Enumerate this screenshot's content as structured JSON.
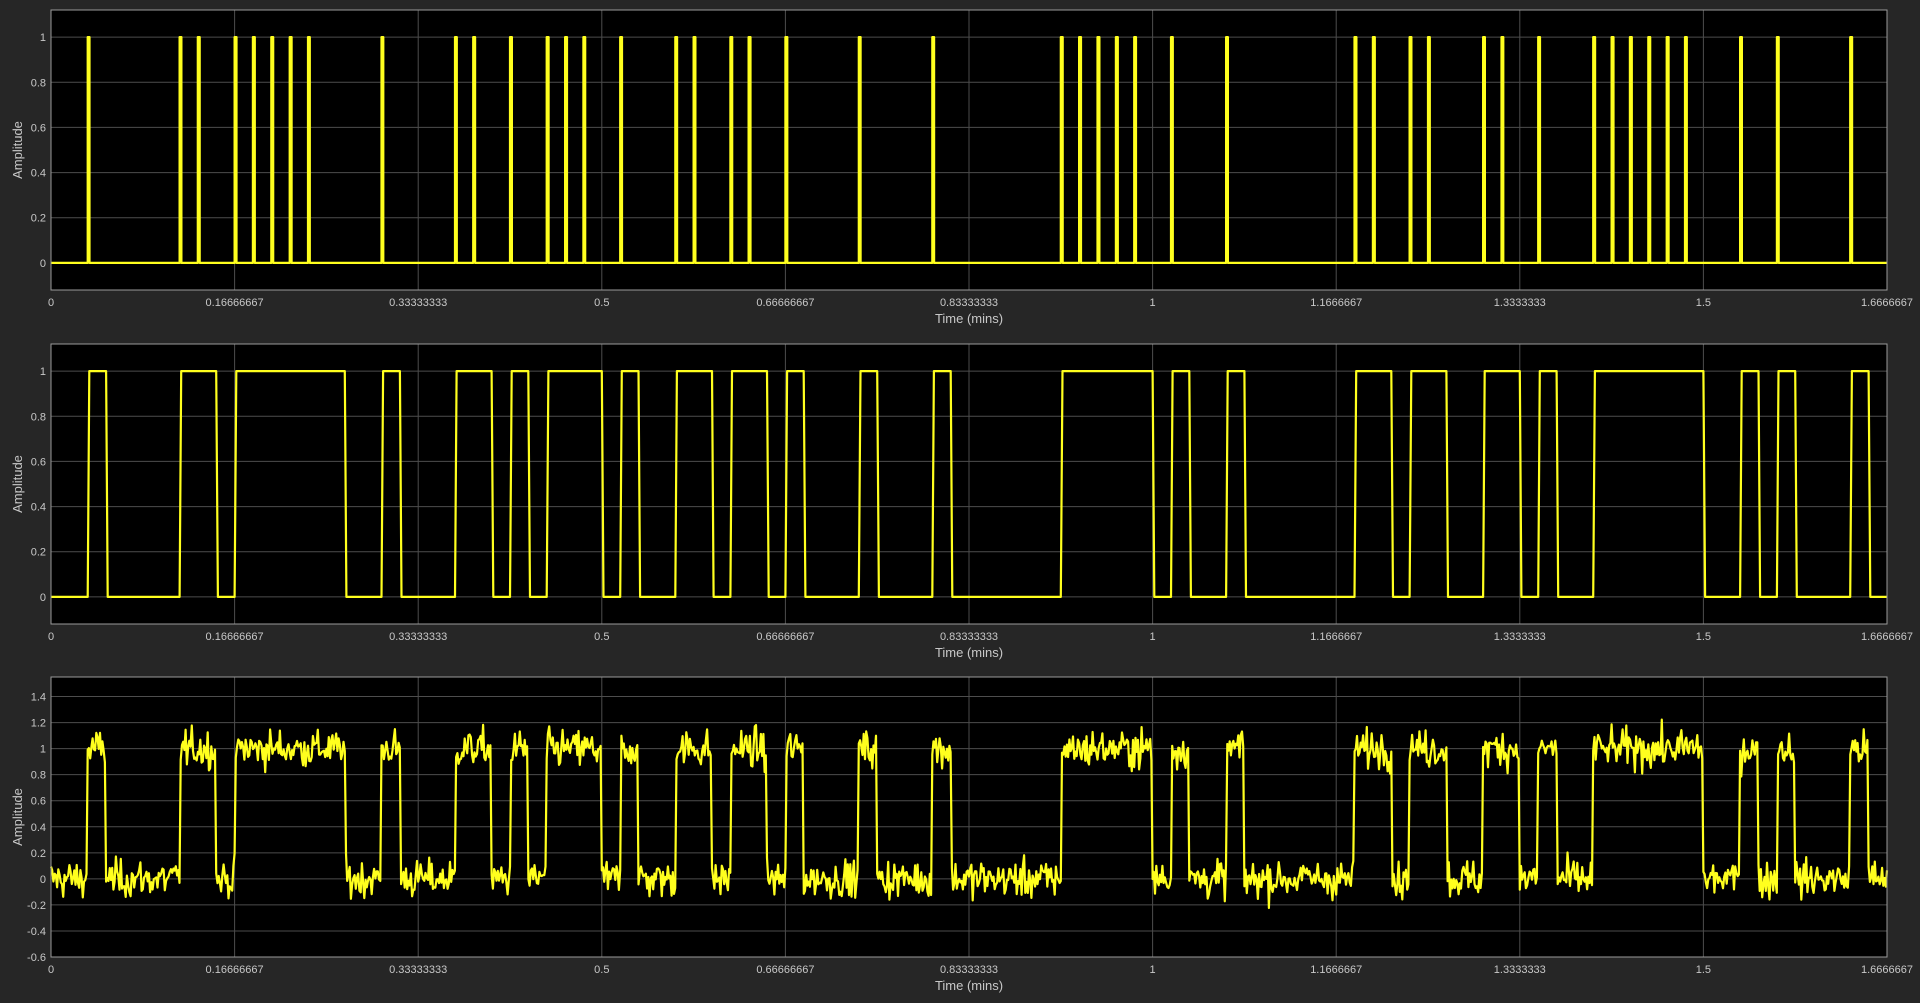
{
  "colors": {
    "figure_background": "#262626",
    "axes_background": "#000000",
    "grid": "#4d4d4d",
    "axis_line": "#9a9a9a",
    "text": "#c8c8c8",
    "trace": "#ffff1e"
  },
  "chart_data": [
    {
      "type": "line",
      "ylabel": "Amplitude",
      "xlabel": "Time (mins)",
      "xlim": [
        0,
        1.6666667
      ],
      "ylim": [
        -0.12,
        1.12
      ],
      "grid": true,
      "xticks": [
        0,
        0.16666667,
        0.33333333,
        0.5,
        0.66666667,
        0.83333333,
        1,
        1.1666667,
        1.3333333,
        1.5,
        1.6666667
      ],
      "xtick_labels": [
        "0",
        "0.16666667",
        "0.33333333",
        "0.5",
        "0.66666667",
        "0.83333333",
        "1",
        "1.1666667",
        "1.3333333",
        "1.5",
        "1.6666667"
      ],
      "yticks": [
        0,
        0.2,
        0.4,
        0.6,
        0.8,
        1
      ],
      "ytick_labels": [
        "0",
        "0.2",
        "0.4",
        "0.6",
        "0.8",
        "1"
      ],
      "signal": "impulse",
      "series": [
        {
          "pulse_width": 0.00167,
          "baseline": 0,
          "pulse_times": [
            0.0333,
            0.1167,
            0.1333,
            0.1667,
            0.1833,
            0.2,
            0.2167,
            0.2333,
            0.3,
            0.3667,
            0.3833,
            0.4167,
            0.45,
            0.4667,
            0.4833,
            0.5167,
            0.5667,
            0.5833,
            0.6167,
            0.6333,
            0.6667,
            0.7333,
            0.8,
            0.9167,
            0.9333,
            0.95,
            0.9667,
            0.9833,
            1.0167,
            1.0667,
            1.1833,
            1.2,
            1.2333,
            1.25,
            1.3,
            1.3167,
            1.35,
            1.4,
            1.4167,
            1.4333,
            1.45,
            1.4667,
            1.4833,
            1.5333,
            1.5667,
            1.6333
          ]
        }
      ]
    },
    {
      "type": "line",
      "ylabel": "Amplitude",
      "xlabel": "Time (mins)",
      "xlim": [
        0,
        1.6666667
      ],
      "ylim": [
        -0.12,
        1.12
      ],
      "grid": true,
      "xticks": [
        0,
        0.16666667,
        0.33333333,
        0.5,
        0.66666667,
        0.83333333,
        1,
        1.1666667,
        1.3333333,
        1.5,
        1.6666667
      ],
      "xtick_labels": [
        "0",
        "0.16666667",
        "0.33333333",
        "0.5",
        "0.66666667",
        "0.83333333",
        "1",
        "1.1666667",
        "1.3333333",
        "1.5",
        "1.6666667"
      ],
      "yticks": [
        0,
        0.2,
        0.4,
        0.6,
        0.8,
        1
      ],
      "ytick_labels": [
        "0",
        "0.2",
        "0.4",
        "0.6",
        "0.8",
        "1"
      ],
      "signal": "square",
      "series": [
        {
          "baseline": 0,
          "high_intervals": [
            [
              0.0333,
              0.05
            ],
            [
              0.1167,
              0.15
            ],
            [
              0.1667,
              0.2667
            ],
            [
              0.3,
              0.3167
            ],
            [
              0.3667,
              0.4
            ],
            [
              0.4167,
              0.4333
            ],
            [
              0.45,
              0.5
            ],
            [
              0.5167,
              0.5333
            ],
            [
              0.5667,
              0.6
            ],
            [
              0.6167,
              0.65
            ],
            [
              0.6667,
              0.6833
            ],
            [
              0.7333,
              0.75
            ],
            [
              0.8,
              0.8167
            ],
            [
              0.9167,
              1.0
            ],
            [
              1.0167,
              1.0333
            ],
            [
              1.0667,
              1.0833
            ],
            [
              1.1833,
              1.2167
            ],
            [
              1.2333,
              1.2667
            ],
            [
              1.3,
              1.3333
            ],
            [
              1.35,
              1.3667
            ],
            [
              1.4,
              1.5
            ],
            [
              1.5333,
              1.55
            ],
            [
              1.5667,
              1.5833
            ],
            [
              1.6333,
              1.65
            ]
          ]
        }
      ]
    },
    {
      "type": "line",
      "ylabel": "Amplitude",
      "xlabel": "Time (mins)",
      "xlim": [
        0,
        1.6666667
      ],
      "ylim": [
        -0.6,
        1.55
      ],
      "grid": true,
      "xticks": [
        0,
        0.16666667,
        0.33333333,
        0.5,
        0.66666667,
        0.83333333,
        1,
        1.1666667,
        1.3333333,
        1.5,
        1.6666667
      ],
      "xtick_labels": [
        "0",
        "0.16666667",
        "0.33333333",
        "0.5",
        "0.66666667",
        "0.83333333",
        "1",
        "1.1666667",
        "1.3333333",
        "1.5",
        "1.6666667"
      ],
      "yticks": [
        -0.6,
        -0.4,
        -0.2,
        0,
        0.2,
        0.4,
        0.6,
        0.8,
        1,
        1.2,
        1.4
      ],
      "ytick_labels": [
        "-0.6",
        "-0.4",
        "-0.2",
        "0",
        "0.2",
        "0.4",
        "0.6",
        "0.8",
        "1",
        "1.2",
        "1.4"
      ],
      "signal": "noisy",
      "series": [
        {
          "source_plot": 1,
          "noise_std": 0.1,
          "noise_range": [
            -0.38,
            1.37
          ],
          "samples": 1500
        }
      ]
    }
  ]
}
